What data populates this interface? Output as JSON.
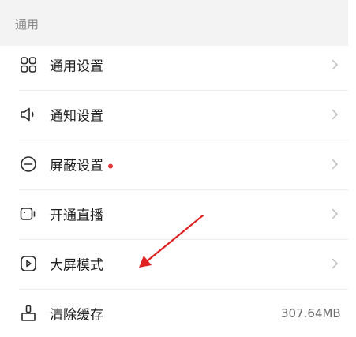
{
  "section": {
    "title": "通用"
  },
  "items": [
    {
      "label": "通用设置",
      "icon": "grid-icon",
      "chevron": true
    },
    {
      "label": "通知设置",
      "icon": "speaker-icon",
      "chevron": true
    },
    {
      "label": "屏蔽设置",
      "icon": "minus-circle-icon",
      "chevron": true,
      "badge_dot": true
    },
    {
      "label": "开通直播",
      "icon": "video-camera-icon",
      "chevron": true
    },
    {
      "label": "大屏模式",
      "icon": "play-screen-icon",
      "chevron": true
    },
    {
      "label": "清除缓存",
      "icon": "broom-icon",
      "value": "307.64MB"
    }
  ],
  "colors": {
    "badge": "#e5393a",
    "annotation_arrow": "#e02020"
  }
}
